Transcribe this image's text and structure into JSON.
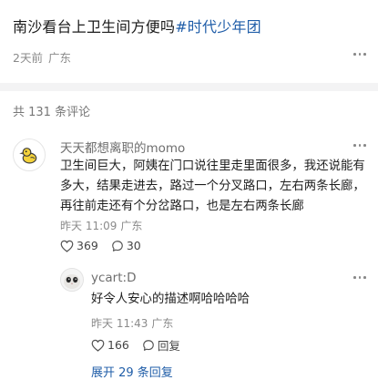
{
  "post": {
    "title": "南沙看台上卫生间方便吗",
    "hashtag": "#时代少年团",
    "time": "2天前",
    "location": "广东"
  },
  "comments_header": {
    "count_text": "共 131 条评论"
  },
  "comments": [
    {
      "username": "天天都想离职的momo",
      "text": "卫生间巨大，阿姨在门口说往里走里面很多，我还说能有多大，结果走进去，路过一个分叉路口，左右两条长廊，再往前走还有个分岔路口，也是左右两条长廊",
      "time": "昨天 11:09",
      "location": "广东",
      "likes": "369",
      "replies": "30",
      "reply": {
        "username": "ycart:D",
        "text": "好令人安心的描述啊哈哈哈哈",
        "time": "昨天 11:43",
        "location": "广东",
        "likes": "166",
        "reply_label": "回复"
      },
      "expand_text": "展开 29 条回复"
    }
  ],
  "colors": {
    "link": "#1f5da8",
    "meta": "#8a8a8a",
    "divider": "#f3f3f4"
  },
  "icons": [
    "more-icon",
    "heart-icon",
    "comment-icon",
    "avatar-duck",
    "avatar-cat"
  ]
}
